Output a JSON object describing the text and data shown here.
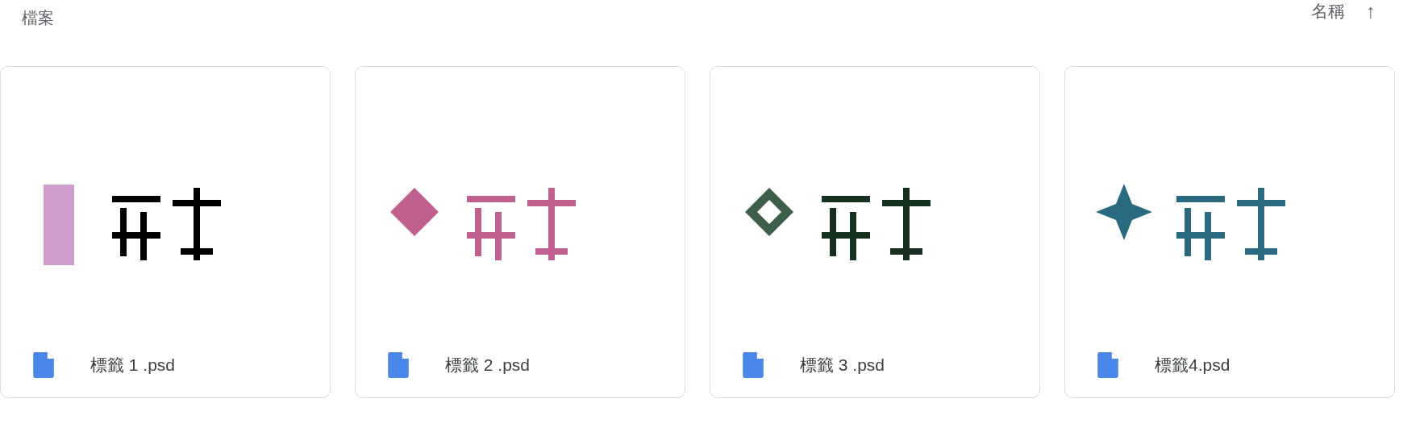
{
  "section_title": "檔案",
  "sort": {
    "label": "名稱",
    "direction_icon": "↑"
  },
  "files": [
    {
      "name": "標籤 1 .psd",
      "kind": "picture"
    },
    {
      "name": "標籤 2 .psd",
      "kind": "picture"
    },
    {
      "name": "標籤 3 .psd",
      "kind": "picture"
    },
    {
      "name": "標籤4.psd",
      "kind": "picture"
    }
  ]
}
